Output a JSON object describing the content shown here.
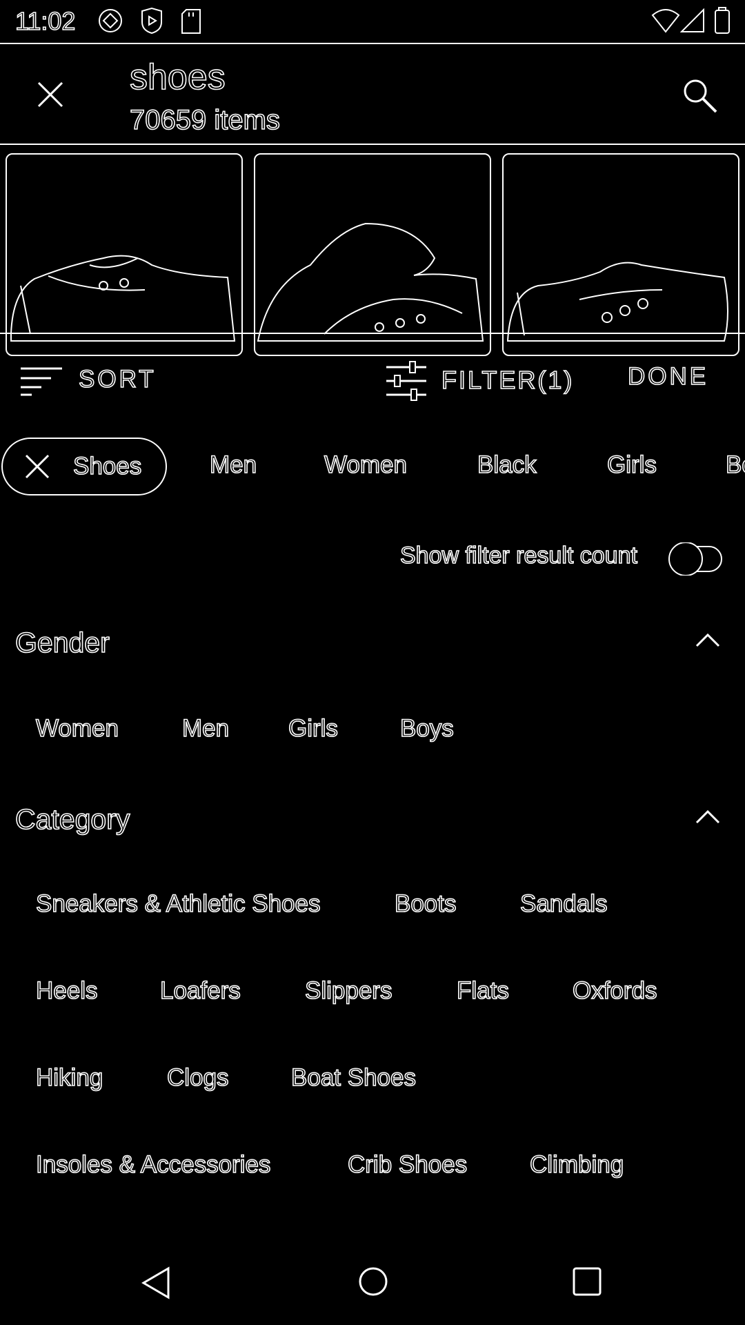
{
  "status_bar": {
    "time": "11:02"
  },
  "search": {
    "query": "shoes",
    "count_text": "70659 items"
  },
  "toolbar": {
    "sort_label": "SORT",
    "filter_label": "FILTER(1)",
    "done_label": "DONE"
  },
  "chips": {
    "selected": "Shoes",
    "suggestions": [
      "Men",
      "Women",
      "Black",
      "Girls",
      "Bo"
    ]
  },
  "filter_count": {
    "label": "Show filter result count",
    "enabled": false
  },
  "gender": {
    "title": "Gender",
    "options": [
      "Women",
      "Men",
      "Girls",
      "Boys"
    ]
  },
  "category": {
    "title": "Category",
    "rows": [
      [
        "Sneakers & Athletic Shoes",
        "Boots",
        "Sandals"
      ],
      [
        "Heels",
        "Loafers",
        "Slippers",
        "Flats",
        "Oxfords"
      ],
      [
        "Hiking",
        "Clogs",
        "Boat Shoes"
      ],
      [
        "Insoles & Accessories",
        "Crib Shoes",
        "Climbing"
      ]
    ]
  },
  "icons": {
    "close": "close-icon",
    "search": "search-icon",
    "sort": "sort-icon",
    "filter": "filter-sliders-icon",
    "chevron": "chevron-up-icon",
    "back": "back-triangle-icon",
    "home": "home-circle-icon",
    "recents": "recents-square-icon"
  }
}
